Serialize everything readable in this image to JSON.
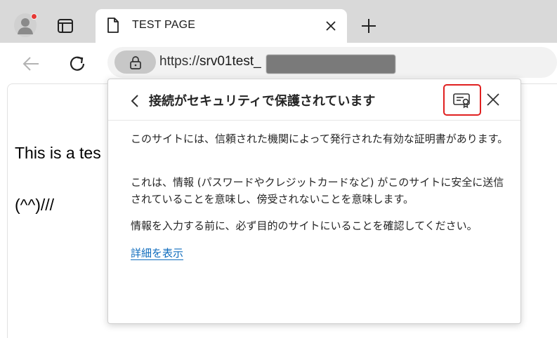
{
  "browser": {
    "tab": {
      "title": "TEST PAGE",
      "icon": "document-icon"
    },
    "toolbar": {
      "url_scheme": "https://",
      "url_host": "srv01test_",
      "lock_icon": "lock-icon"
    },
    "colors": {
      "accent": "#0f6cbd",
      "highlight": "#e02020",
      "notification": "#e53935"
    }
  },
  "page": {
    "line1": "This is a tes",
    "line2": "(^^)///"
  },
  "security_popup": {
    "title": "接続がセキュリティで保護されています",
    "paragraph1": "このサイトには、信頼された機関によって発行された有効な証明書があります。",
    "paragraph2": "これは、情報 (パスワードやクレジットカードなど) がこのサイトに安全に送信されていることを意味し、傍受されないことを意味します。",
    "paragraph3": "情報を入力する前に、必ず目的のサイトにいることを確認してください。",
    "details_link": "詳細を表示",
    "certificate_icon": "certificate-icon"
  }
}
